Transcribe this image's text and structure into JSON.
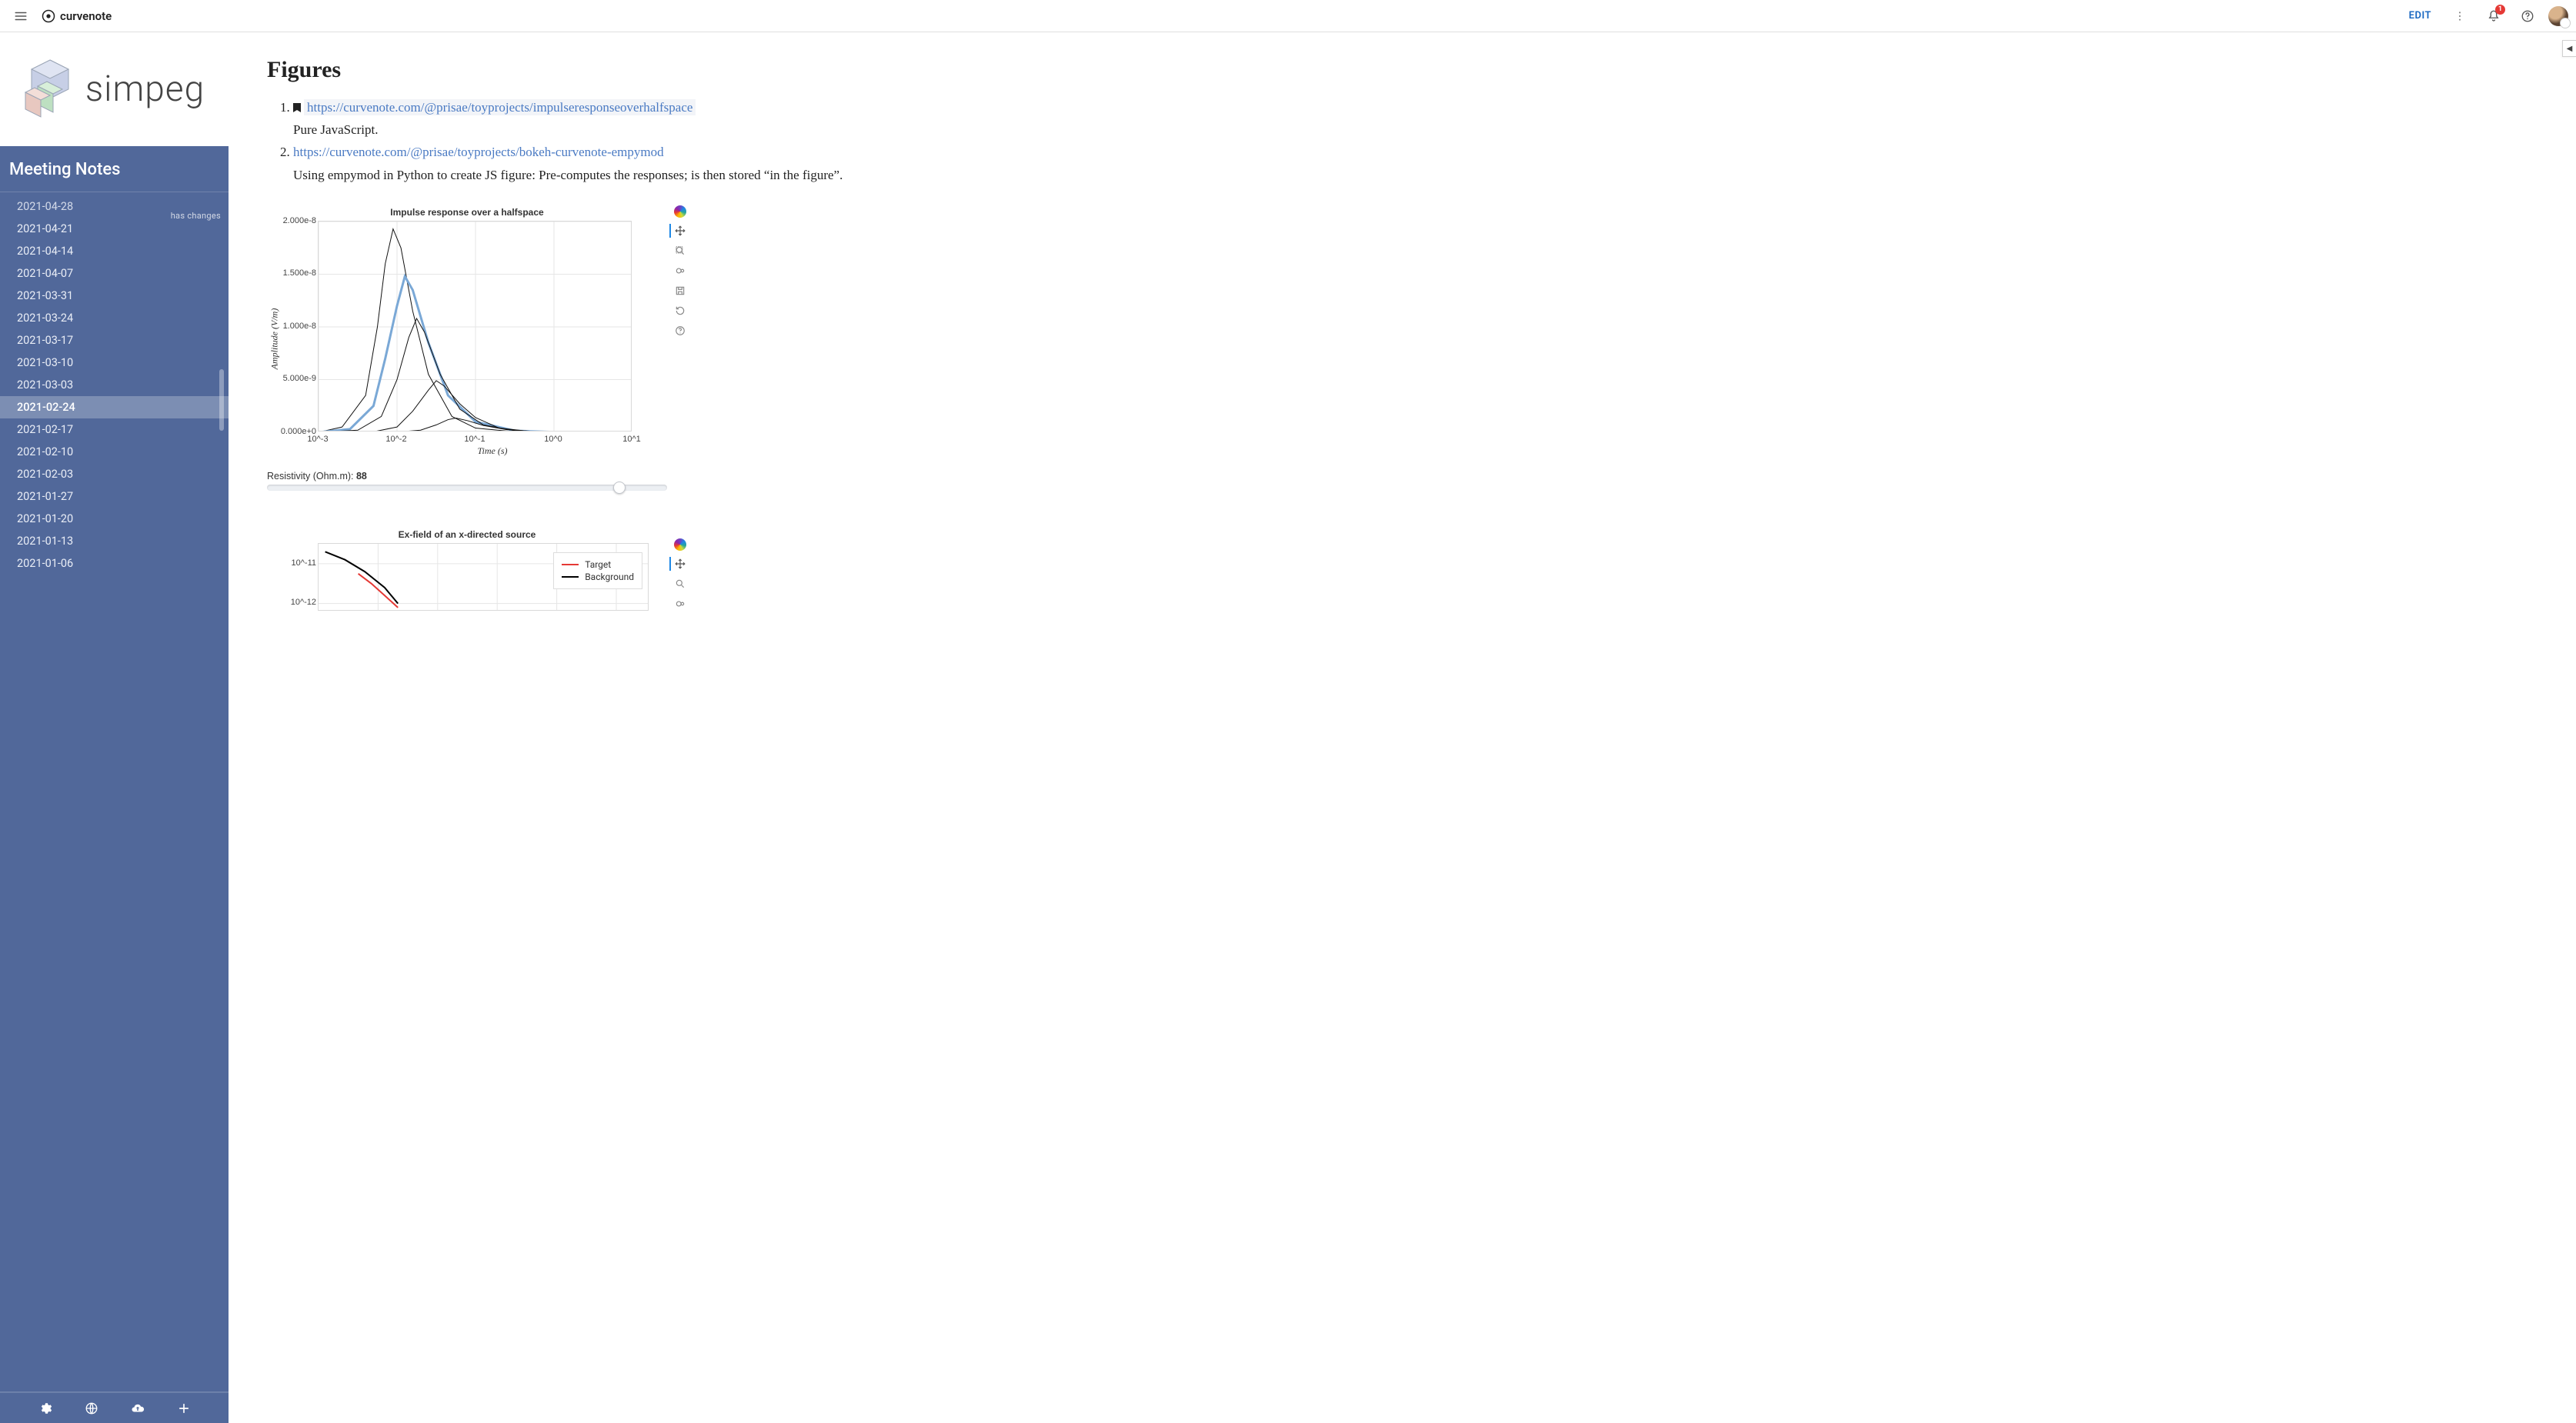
{
  "brand": "curvenote",
  "header": {
    "edit": "EDIT",
    "notification_count": "1"
  },
  "sidebar": {
    "title": "Meeting Notes",
    "logo_text": "simpeg",
    "has_changes": "has changes",
    "items": [
      {
        "label": "2021-04-28",
        "cut": true
      },
      {
        "label": "2021-04-21"
      },
      {
        "label": "2021-04-14"
      },
      {
        "label": "2021-04-07"
      },
      {
        "label": "2021-03-31"
      },
      {
        "label": "2021-03-24"
      },
      {
        "label": "2021-03-17"
      },
      {
        "label": "2021-03-10"
      },
      {
        "label": "2021-03-03"
      },
      {
        "label": "2021-02-24",
        "selected": true
      },
      {
        "label": "2021-02-17"
      },
      {
        "label": "2021-02-10"
      },
      {
        "label": "2021-02-03"
      },
      {
        "label": "2021-01-27"
      },
      {
        "label": "2021-01-20"
      },
      {
        "label": "2021-01-13"
      },
      {
        "label": "2021-01-06"
      }
    ]
  },
  "article": {
    "heading": "Figures",
    "list": [
      {
        "url": "https://curvenote.com/@prisae/toyprojects/impulseresponseoverhalfspace",
        "desc": "Pure JavaScript."
      },
      {
        "url": "https://curvenote.com/@prisae/toyprojects/bokeh-curvenote-empymod",
        "desc": "Using empymod in Python to create JS figure: Pre-computes the responses; is then stored “in the figure”."
      }
    ]
  },
  "chart_data": [
    {
      "type": "line",
      "title": "Impulse response over a halfspace",
      "xlabel": "Time (s)",
      "ylabel": "Amplitude (V/m)",
      "x_scale": "log",
      "x_ticks": [
        "10^-3",
        "10^-2",
        "10^-1",
        "10^0",
        "10^1"
      ],
      "y_ticks": [
        "0.000e+0",
        "5.000e-9",
        "1.000e-8",
        "1.500e-8",
        "2.000e-8"
      ],
      "ylim": [
        0,
        2e-08
      ],
      "slider": {
        "label": "Resistivity (Ohm.m): ",
        "value": "88",
        "position": 0.88
      },
      "toolbar": [
        "pan",
        "box-zoom",
        "wheel-zoom",
        "save",
        "reset",
        "help"
      ],
      "series": [
        {
          "name": "curve-a",
          "color": "#111",
          "width": 1,
          "points": [
            [
              -3,
              0
            ],
            [
              -2.7,
              5e-10
            ],
            [
              -2.4,
              3.5e-09
            ],
            [
              -2.25,
              1e-08
            ],
            [
              -2.15,
              1.6e-08
            ],
            [
              -2.05,
              1.93e-08
            ],
            [
              -1.95,
              1.75e-08
            ],
            [
              -1.8,
              1.15e-08
            ],
            [
              -1.6,
              5.5e-09
            ],
            [
              -1.3,
              1.5e-09
            ],
            [
              -1.0,
              4e-10
            ],
            [
              -0.5,
              5e-11
            ],
            [
              0,
              0.0
            ],
            [
              1,
              0
            ]
          ]
        },
        {
          "name": "curve-b",
          "color": "#7aa8d6",
          "width": 3,
          "points": [
            [
              -3,
              0
            ],
            [
              -2.6,
              3e-10
            ],
            [
              -2.3,
              2.5e-09
            ],
            [
              -2.15,
              7e-09
            ],
            [
              -2.0,
              1.2e-08
            ],
            [
              -1.9,
              1.48e-08
            ],
            [
              -1.8,
              1.35e-08
            ],
            [
              -1.6,
              8.5e-09
            ],
            [
              -1.35,
              3.5e-09
            ],
            [
              -1.0,
              1e-09
            ],
            [
              -0.5,
              1.5e-10
            ],
            [
              0,
              2e-11
            ],
            [
              1,
              0
            ]
          ]
        },
        {
          "name": "curve-c",
          "color": "#111",
          "width": 1,
          "points": [
            [
              -3,
              0
            ],
            [
              -2.5,
              2e-10
            ],
            [
              -2.2,
              1.5e-09
            ],
            [
              -2.0,
              5e-09
            ],
            [
              -1.85,
              9e-09
            ],
            [
              -1.75,
              1.08e-08
            ],
            [
              -1.65,
              9.5e-09
            ],
            [
              -1.45,
              5.5e-09
            ],
            [
              -1.2,
              2.2e-09
            ],
            [
              -0.9,
              7e-10
            ],
            [
              -0.5,
              1.5e-10
            ],
            [
              0,
              2e-11
            ],
            [
              1,
              0
            ]
          ]
        },
        {
          "name": "curve-d",
          "color": "#111",
          "width": 1,
          "points": [
            [
              -3,
              0
            ],
            [
              -2.3,
              5e-11
            ],
            [
              -2.0,
              5e-10
            ],
            [
              -1.8,
              2e-09
            ],
            [
              -1.6,
              4e-09
            ],
            [
              -1.5,
              4.9e-09
            ],
            [
              -1.4,
              4.4e-09
            ],
            [
              -1.2,
              2.7e-09
            ],
            [
              -1.0,
              1.4e-09
            ],
            [
              -0.7,
              4e-10
            ],
            [
              -0.3,
              8e-11
            ],
            [
              0,
              2e-11
            ],
            [
              1,
              0
            ]
          ]
        },
        {
          "name": "curve-e",
          "color": "#111",
          "width": 1,
          "points": [
            [
              -3,
              0
            ],
            [
              -2.0,
              2e-11
            ],
            [
              -1.7,
              2e-10
            ],
            [
              -1.5,
              7e-10
            ],
            [
              -1.35,
              1.2e-09
            ],
            [
              -1.25,
              1.35e-09
            ],
            [
              -1.1,
              1.1e-09
            ],
            [
              -0.9,
              6.5e-10
            ],
            [
              -0.6,
              2.5e-10
            ],
            [
              -0.2,
              6e-11
            ],
            [
              0.3,
              1e-11
            ],
            [
              1,
              0
            ]
          ]
        }
      ]
    },
    {
      "type": "line",
      "title": "Ex-field of an x-directed source",
      "y_scale": "log",
      "y_ticks": [
        "10^-11",
        "10^-12"
      ],
      "legend": [
        {
          "name": "Target",
          "color": "#e53935"
        },
        {
          "name": "Background",
          "color": "#000000"
        }
      ],
      "toolbar": [
        "pan",
        "box-zoom",
        "wheel-zoom"
      ],
      "series": [
        {
          "name": "Background",
          "color": "#000",
          "width": 2,
          "points": [
            [
              0.02,
              -10.7
            ],
            [
              0.08,
              -10.9
            ],
            [
              0.14,
              -11.2
            ],
            [
              0.2,
              -11.6
            ],
            [
              0.24,
              -12.0
            ]
          ]
        },
        {
          "name": "Target",
          "color": "#e53935",
          "width": 2,
          "points": [
            [
              0.12,
              -11.25
            ],
            [
              0.16,
              -11.5
            ],
            [
              0.2,
              -11.8
            ],
            [
              0.24,
              -12.1
            ]
          ]
        }
      ]
    }
  ]
}
